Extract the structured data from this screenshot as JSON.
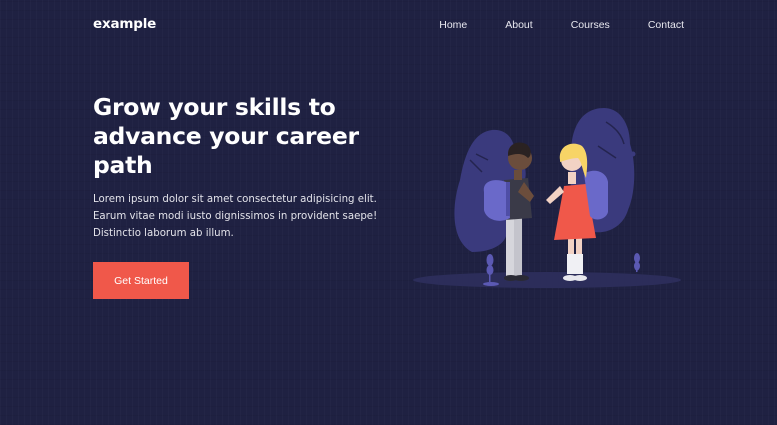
{
  "header": {
    "logo": "example",
    "nav": [
      {
        "label": "Home"
      },
      {
        "label": "About"
      },
      {
        "label": "Courses"
      },
      {
        "label": "Contact"
      }
    ]
  },
  "hero": {
    "title": "Grow your skills to advance your career path",
    "description": "Lorem ipsum dolor sit amet consectetur adipisicing elit. Earum vitae modi iusto dignissimos in provident saepe! Distinctio laborum ab illum.",
    "cta_label": "Get Started"
  },
  "colors": {
    "background": "#1f2142",
    "accent": "#f0584a",
    "illustration_purple": "#5b59b3"
  },
  "illustration": {
    "icon": "students-with-backpacks-illustration"
  }
}
